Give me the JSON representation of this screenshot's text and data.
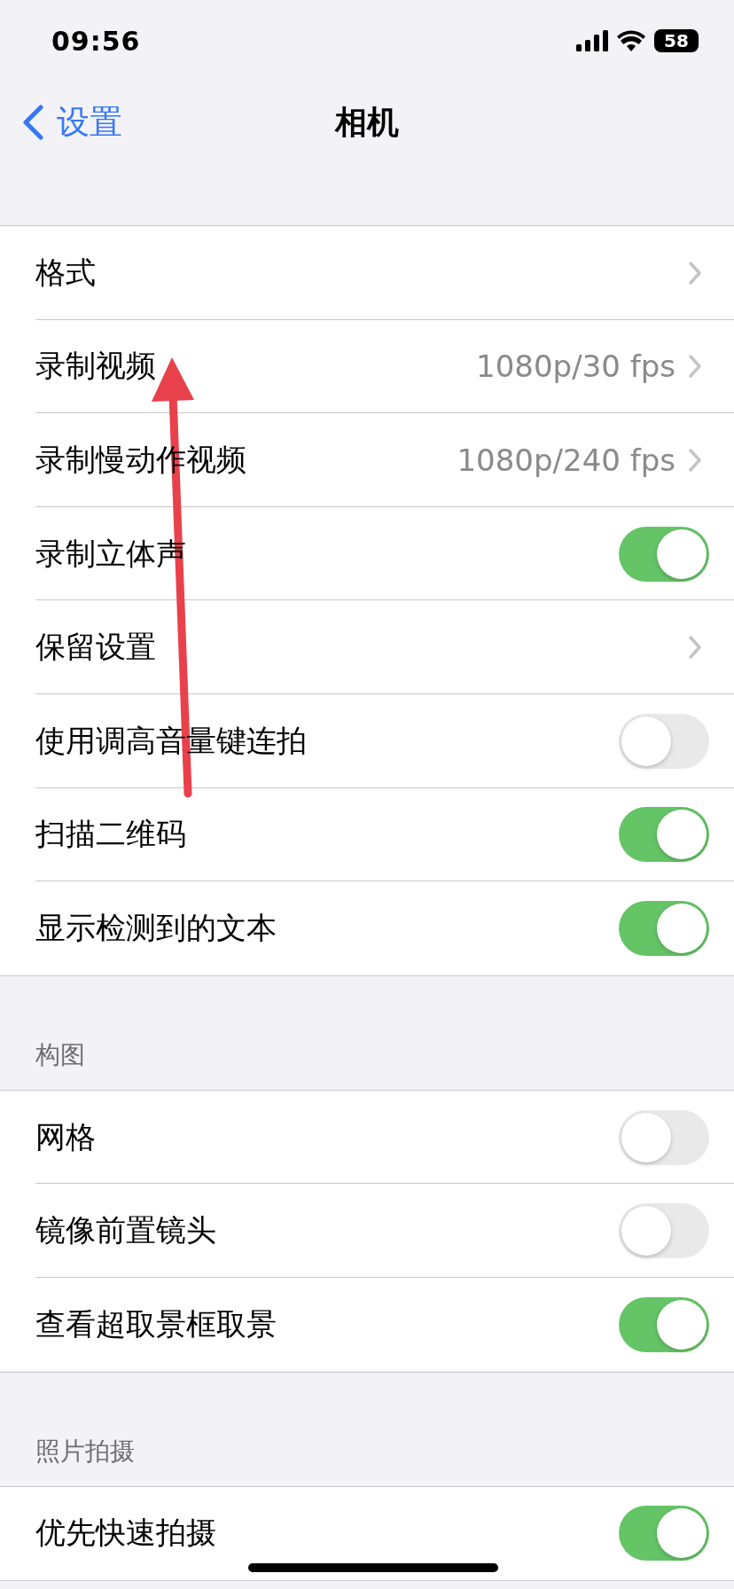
{
  "status_bar": {
    "time": "09:56",
    "battery": "58"
  },
  "nav": {
    "back": "设置",
    "title": "相机"
  },
  "sections": [
    {
      "rows": [
        {
          "kind": "link",
          "label": "格式"
        },
        {
          "kind": "link",
          "label": "录制视频",
          "value": "1080p/30 fps"
        },
        {
          "kind": "link",
          "label": "录制慢动作视频",
          "value": "1080p/240 fps"
        },
        {
          "kind": "toggle",
          "label": "录制立体声",
          "on": true
        },
        {
          "kind": "link",
          "label": "保留设置"
        },
        {
          "kind": "toggle",
          "label": "使用调高音量键连拍",
          "on": false
        },
        {
          "kind": "toggle",
          "label": "扫描二维码",
          "on": true
        },
        {
          "kind": "toggle",
          "label": "显示检测到的文本",
          "on": true
        }
      ]
    },
    {
      "header": "构图",
      "rows": [
        {
          "kind": "toggle",
          "label": "网格",
          "on": false
        },
        {
          "kind": "toggle",
          "label": "镜像前置镜头",
          "on": false
        },
        {
          "kind": "toggle",
          "label": "查看超取景框取景",
          "on": true
        }
      ]
    },
    {
      "header": "照片拍摄",
      "rows": [
        {
          "kind": "toggle",
          "label": "优先快速拍摄",
          "on": true
        }
      ]
    }
  ]
}
